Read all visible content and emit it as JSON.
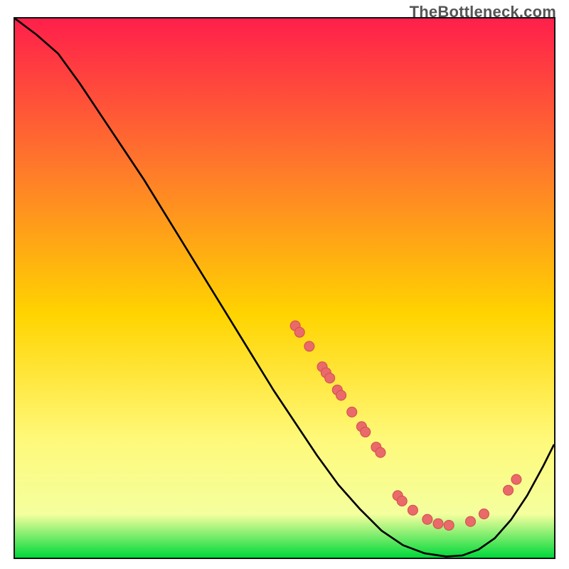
{
  "watermark": "TheBottleneck.com",
  "colors": {
    "top": "#ff1f4b",
    "mid_upper": "#ff7a2a",
    "mid": "#ffd400",
    "mid_lower": "#fff97a",
    "near_bottom": "#f4ff9e",
    "bottom": "#00d93a",
    "curve": "#000000",
    "point_fill": "#ea6a6a",
    "point_stroke": "#d25252"
  },
  "chart_data": {
    "type": "line",
    "title": "",
    "xlabel": "",
    "ylabel": "",
    "xlim": [
      0,
      100
    ],
    "ylim": [
      0,
      100
    ],
    "grid": false,
    "legend": false,
    "series": [
      {
        "name": "curve",
        "x": [
          0,
          4,
          8,
          12,
          16,
          20,
          24,
          28,
          32,
          36,
          40,
          44,
          48,
          52,
          56,
          60,
          64,
          68,
          72,
          76,
          80,
          83,
          86,
          89,
          92,
          95,
          98,
          100
        ],
        "y": [
          100,
          97,
          93.5,
          88,
          82,
          76,
          70,
          63.5,
          57,
          50.5,
          44,
          37.5,
          31,
          25,
          19,
          13.5,
          9,
          5,
          2.3,
          0.8,
          0.2,
          0.4,
          1.5,
          3.6,
          7,
          11.5,
          17,
          21
        ]
      }
    ],
    "points": [
      {
        "x": 52.0,
        "y": 43.0
      },
      {
        "x": 52.8,
        "y": 41.8
      },
      {
        "x": 54.6,
        "y": 39.2
      },
      {
        "x": 57.0,
        "y": 35.4
      },
      {
        "x": 57.7,
        "y": 34.3
      },
      {
        "x": 58.4,
        "y": 33.3
      },
      {
        "x": 59.8,
        "y": 31.1
      },
      {
        "x": 60.5,
        "y": 30.1
      },
      {
        "x": 62.5,
        "y": 27.0
      },
      {
        "x": 64.3,
        "y": 24.3
      },
      {
        "x": 65.0,
        "y": 23.3
      },
      {
        "x": 67.0,
        "y": 20.5
      },
      {
        "x": 67.8,
        "y": 19.5
      },
      {
        "x": 71.0,
        "y": 11.5
      },
      {
        "x": 71.8,
        "y": 10.5
      },
      {
        "x": 73.8,
        "y": 8.8
      },
      {
        "x": 76.5,
        "y": 7.1
      },
      {
        "x": 78.5,
        "y": 6.3
      },
      {
        "x": 80.5,
        "y": 6.0
      },
      {
        "x": 84.5,
        "y": 6.7
      },
      {
        "x": 87.0,
        "y": 8.1
      },
      {
        "x": 91.5,
        "y": 12.5
      },
      {
        "x": 93.0,
        "y": 14.5
      }
    ],
    "point_radius": 7
  }
}
